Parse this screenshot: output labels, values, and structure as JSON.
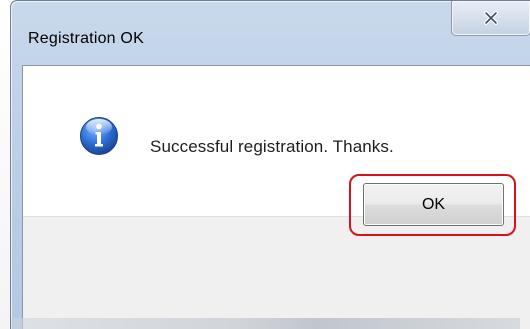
{
  "window": {
    "title": "Registration OK",
    "close_icon": "close-icon"
  },
  "message": {
    "icon": "info-icon",
    "text": "Successful registration. Thanks."
  },
  "buttons": {
    "ok_label": "OK"
  },
  "colors": {
    "title_bar": "#bcd0e8",
    "highlight": "#d8121b",
    "footer": "#f0f0f0",
    "info_icon": "#1f5fc2"
  }
}
